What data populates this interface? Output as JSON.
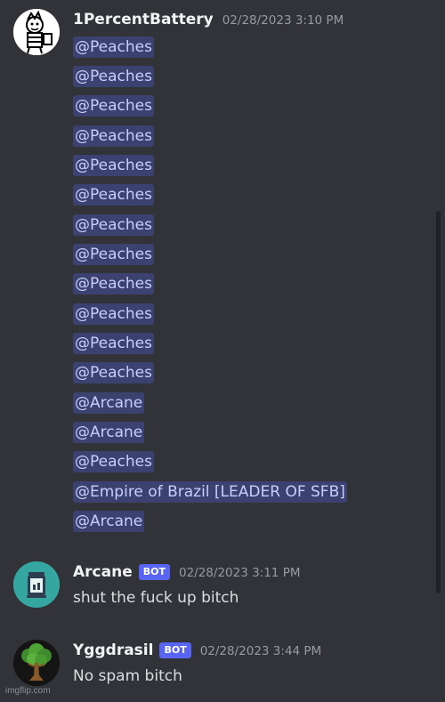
{
  "messages": {
    "first": {
      "username": "1PercentBattery",
      "timestamp": "02/28/2023 3:10 PM",
      "mentions": [
        "@Peaches",
        "@Peaches",
        "@Peaches",
        "@Peaches",
        "@Peaches",
        "@Peaches",
        "@Peaches",
        "@Peaches",
        "@Peaches",
        "@Peaches",
        "@Peaches",
        "@Peaches",
        "@Arcane",
        "@Arcane",
        "@Peaches",
        "@Empire of Brazil [LEADER OF SFB]",
        "@Arcane"
      ]
    },
    "second": {
      "username": "Arcane",
      "bot_label": "BOT",
      "timestamp": "02/28/2023 3:11 PM",
      "content": "shut the fuck up bitch"
    },
    "third": {
      "username": "Yggdrasil",
      "bot_label": "BOT",
      "timestamp": "02/28/2023 3:44 PM",
      "content": "No spam bitch"
    }
  },
  "colors": {
    "background": "#313338",
    "mention_bg": "#3c4270",
    "mention_text": "#c9cdfb",
    "bot_tag": "#5865f2"
  },
  "watermark": "imgflip.com"
}
